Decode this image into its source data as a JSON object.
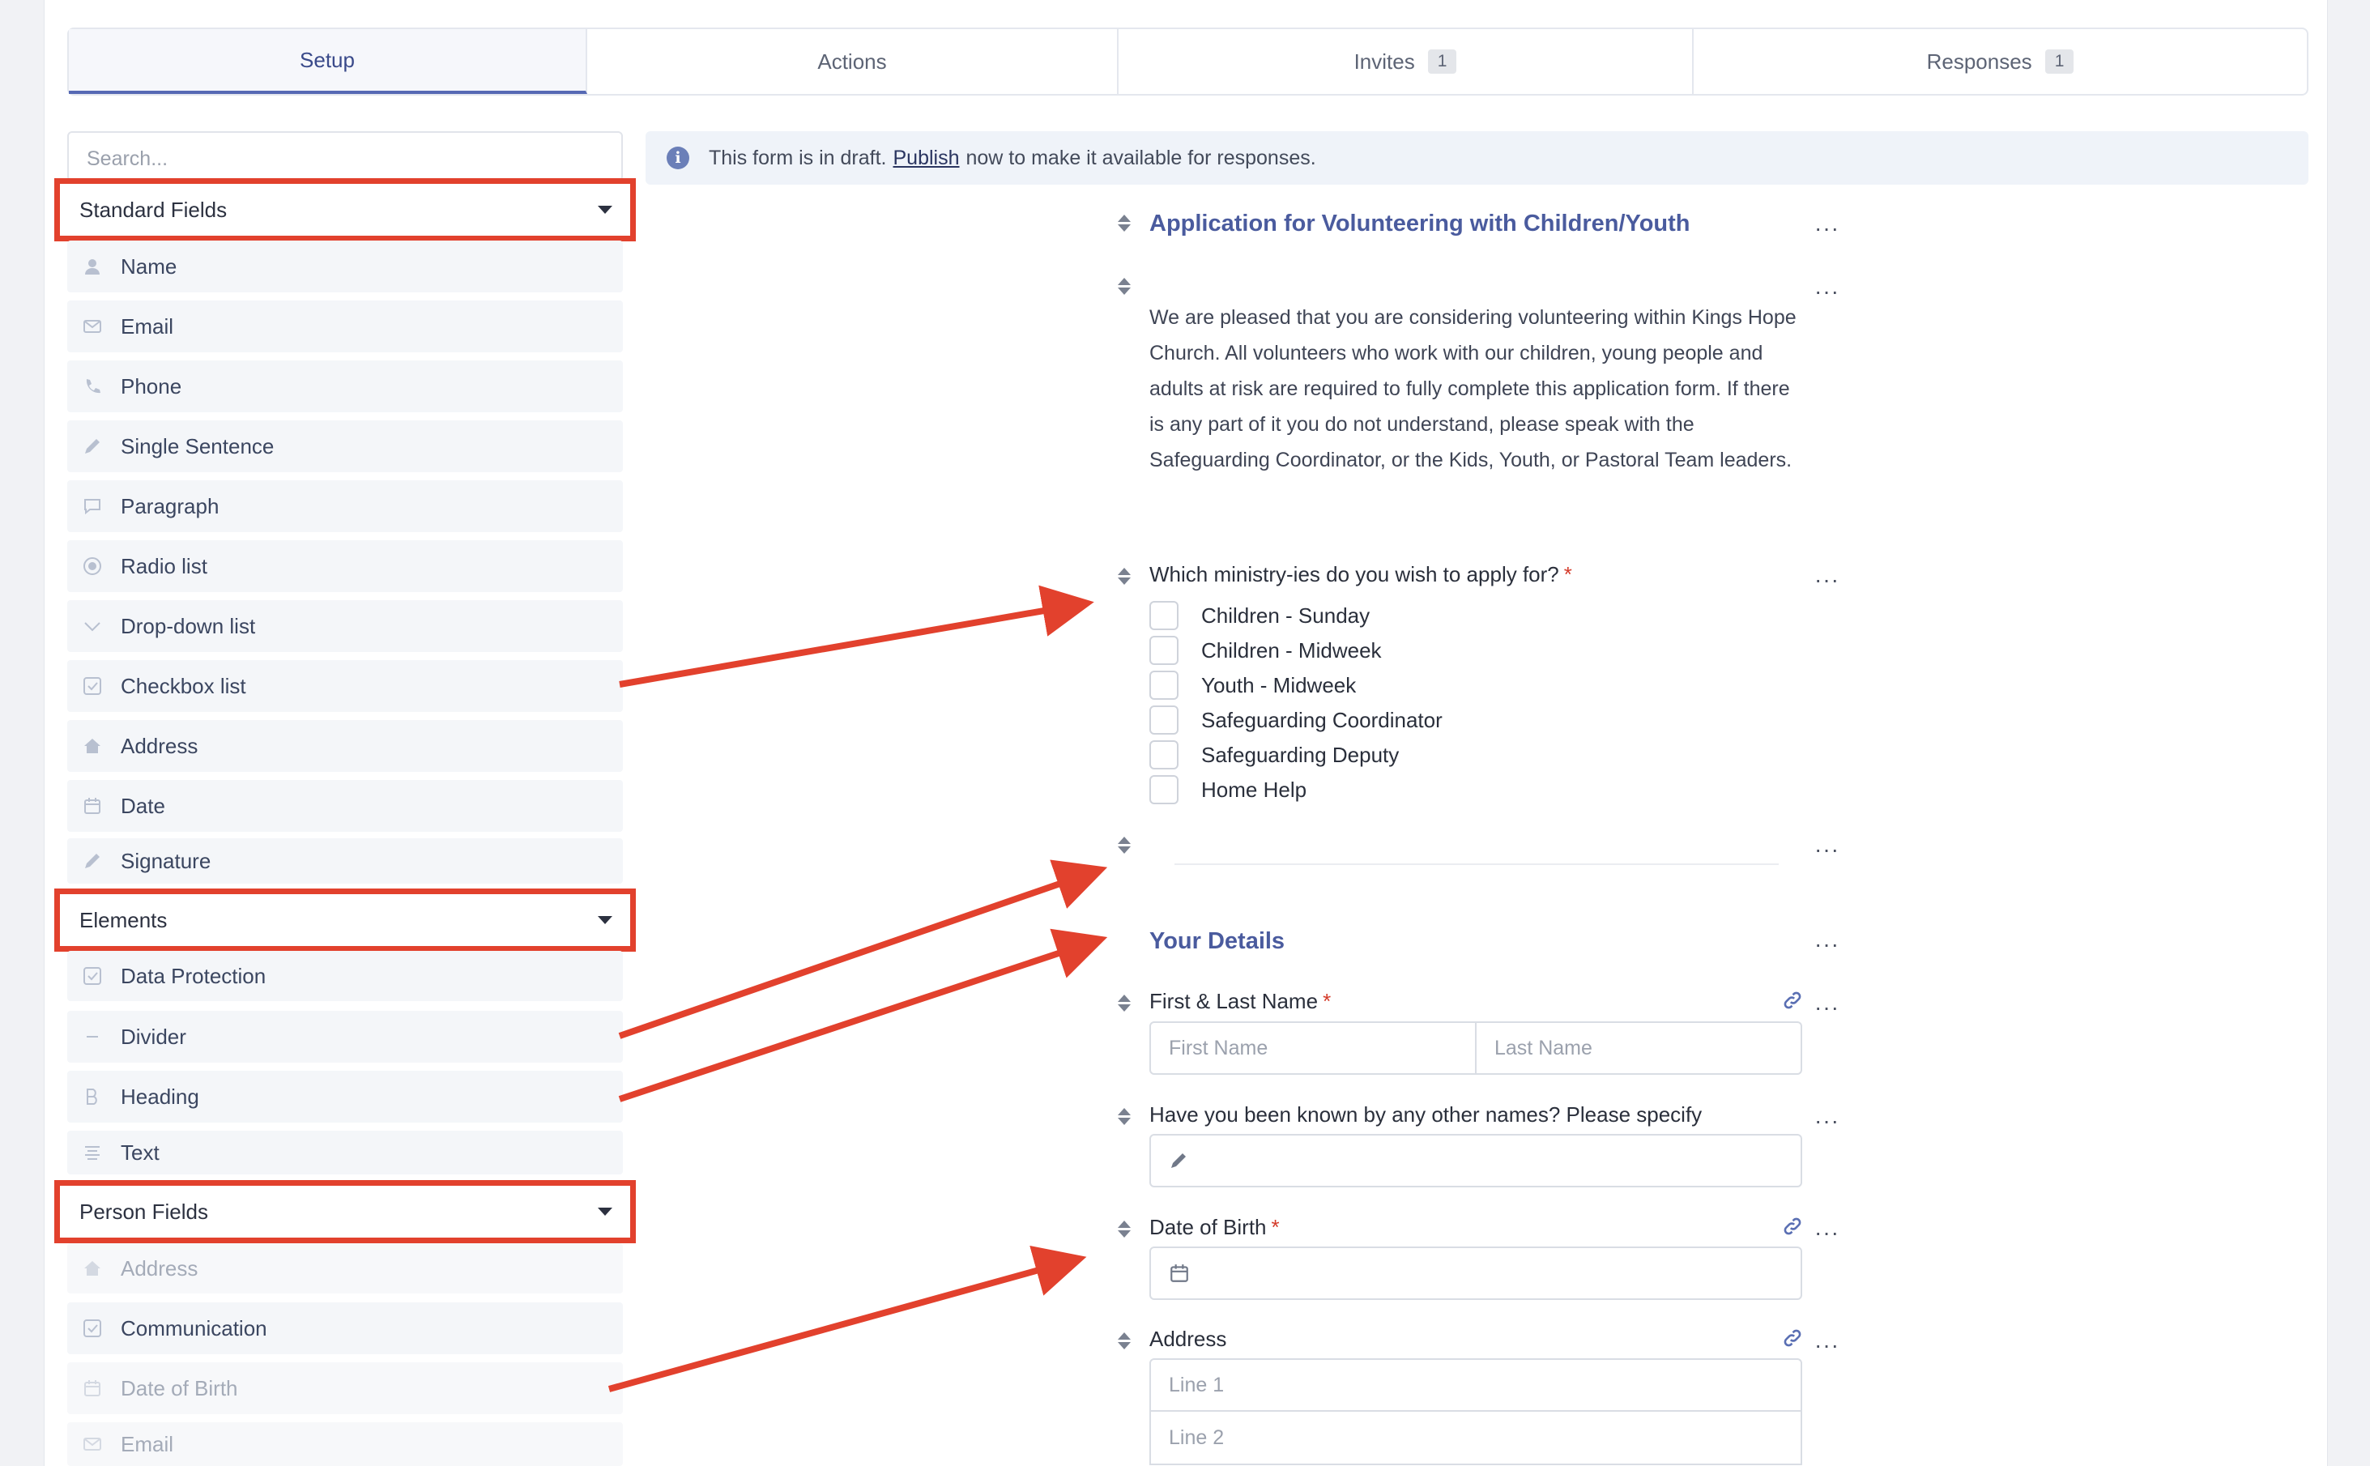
{
  "tabs": [
    {
      "label": "Setup",
      "count": ""
    },
    {
      "label": "Actions",
      "count": ""
    },
    {
      "label": "Invites",
      "count": "1"
    },
    {
      "label": "Responses",
      "count": "1"
    }
  ],
  "sidebar": {
    "search_placeholder": "Search...",
    "groups": [
      {
        "label": "Standard Fields"
      },
      {
        "label": "Elements"
      },
      {
        "label": "Person Fields"
      }
    ],
    "standard_fields": [
      {
        "label": "Name",
        "icon": "person-icon"
      },
      {
        "label": "Email",
        "icon": "envelope-icon"
      },
      {
        "label": "Phone",
        "icon": "phone-icon"
      },
      {
        "label": "Single Sentence",
        "icon": "pencil-icon"
      },
      {
        "label": "Paragraph",
        "icon": "comment-icon"
      },
      {
        "label": "Radio list",
        "icon": "radio-icon"
      },
      {
        "label": "Drop-down list",
        "icon": "chevron-down-icon"
      },
      {
        "label": "Checkbox list",
        "icon": "checkbox-icon"
      },
      {
        "label": "Address",
        "icon": "home-icon"
      },
      {
        "label": "Date",
        "icon": "calendar-icon"
      },
      {
        "label": "Signature",
        "icon": "pencil-icon"
      }
    ],
    "elements": [
      {
        "label": "Data Protection",
        "icon": "checkbox-icon"
      },
      {
        "label": "Divider",
        "icon": "minus-icon"
      },
      {
        "label": "Heading",
        "icon": "bold-icon"
      },
      {
        "label": "Text",
        "icon": "align-center-icon"
      }
    ],
    "person_fields": [
      {
        "label": "Address",
        "icon": "home-icon"
      },
      {
        "label": "Communication",
        "icon": "checkbox-icon"
      },
      {
        "label": "Date of Birth",
        "icon": "calendar-icon"
      },
      {
        "label": "Email",
        "icon": "envelope-icon"
      }
    ]
  },
  "notice": {
    "before": "This form is in draft.",
    "link": "Publish",
    "after": "now to make it available for responses."
  },
  "form": {
    "title": "Application for Volunteering with Children/Youth",
    "intro": "We are pleased that you are considering volunteering within Kings Hope Church. All volunteers who work with our children, young people and adults at risk are required to fully complete this application form. If there is any part of it you do not understand, please speak with the Safeguarding Coordinator, or the Kids, Youth, or Pastoral Team leaders.",
    "ministry_question": "Which ministry-ies do you wish to apply for?",
    "ministry_options": [
      "Children - Sunday",
      "Children - Midweek",
      "Youth - Midweek",
      "Safeguarding Coordinator",
      "Safeguarding Deputy",
      "Home Help"
    ],
    "section_heading": "Your Details",
    "name_label": "First & Last Name",
    "first_placeholder": "First Name",
    "last_placeholder": "Last Name",
    "other_names_label": "Have you been known by any other names? Please specify",
    "dob_label": "Date of Birth",
    "address_label": "Address",
    "line1_placeholder": "Line 1",
    "line2_placeholder": "Line 2",
    "required_mark": "*",
    "more_glyph": "···"
  },
  "colors": {
    "accent": "#5669b4",
    "highlight": "#e2412d",
    "heading": "#4a5b9e"
  }
}
